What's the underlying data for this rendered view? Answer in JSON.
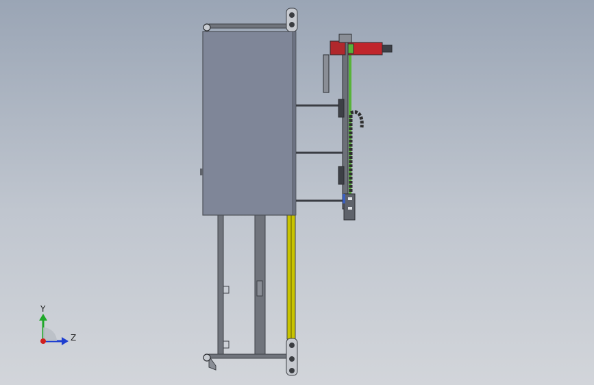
{
  "viewport": {
    "background_top": "#9aa5b5",
    "background_bottom": "#d2d5da"
  },
  "model": {
    "cabinet_color": "#7f8698",
    "frame_color": "#5f636b",
    "rail_color": "#c9c400",
    "motor_color": "#c0252b",
    "cable_color": "#2e2e2e",
    "guide_color": "#58b33a"
  },
  "triad": {
    "y_label": "Y",
    "z_label": "Z",
    "y_color": "#1fa82a",
    "z_color": "#1f3fd0",
    "x_color": "#d01f1f"
  }
}
